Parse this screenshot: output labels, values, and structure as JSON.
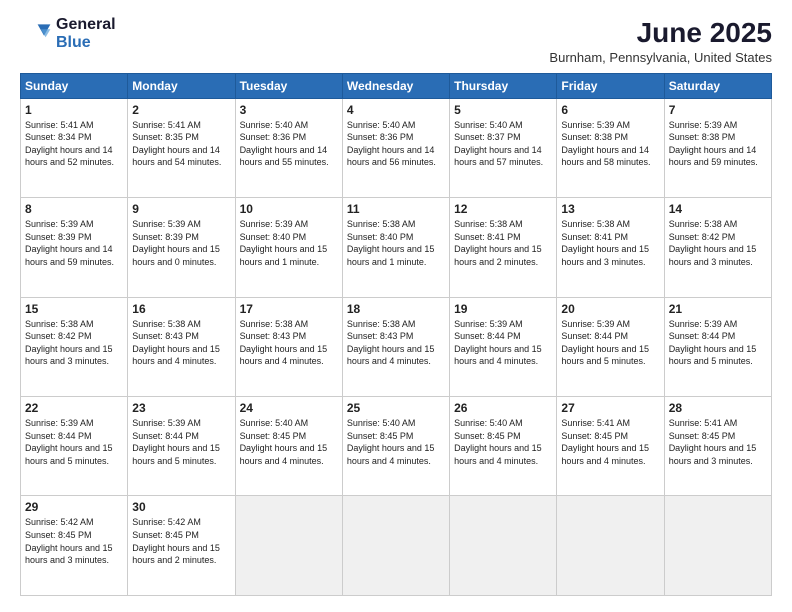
{
  "header": {
    "logo_general": "General",
    "logo_blue": "Blue",
    "month_title": "June 2025",
    "location": "Burnham, Pennsylvania, United States"
  },
  "days_of_week": [
    "Sunday",
    "Monday",
    "Tuesday",
    "Wednesday",
    "Thursday",
    "Friday",
    "Saturday"
  ],
  "weeks": [
    [
      {
        "day": "1",
        "sunrise": "5:41 AM",
        "sunset": "8:34 PM",
        "daylight": "14 hours and 52 minutes."
      },
      {
        "day": "2",
        "sunrise": "5:41 AM",
        "sunset": "8:35 PM",
        "daylight": "14 hours and 54 minutes."
      },
      {
        "day": "3",
        "sunrise": "5:40 AM",
        "sunset": "8:36 PM",
        "daylight": "14 hours and 55 minutes."
      },
      {
        "day": "4",
        "sunrise": "5:40 AM",
        "sunset": "8:36 PM",
        "daylight": "14 hours and 56 minutes."
      },
      {
        "day": "5",
        "sunrise": "5:40 AM",
        "sunset": "8:37 PM",
        "daylight": "14 hours and 57 minutes."
      },
      {
        "day": "6",
        "sunrise": "5:39 AM",
        "sunset": "8:38 PM",
        "daylight": "14 hours and 58 minutes."
      },
      {
        "day": "7",
        "sunrise": "5:39 AM",
        "sunset": "8:38 PM",
        "daylight": "14 hours and 59 minutes."
      }
    ],
    [
      {
        "day": "8",
        "sunrise": "5:39 AM",
        "sunset": "8:39 PM",
        "daylight": "14 hours and 59 minutes."
      },
      {
        "day": "9",
        "sunrise": "5:39 AM",
        "sunset": "8:39 PM",
        "daylight": "15 hours and 0 minutes."
      },
      {
        "day": "10",
        "sunrise": "5:39 AM",
        "sunset": "8:40 PM",
        "daylight": "15 hours and 1 minute."
      },
      {
        "day": "11",
        "sunrise": "5:38 AM",
        "sunset": "8:40 PM",
        "daylight": "15 hours and 1 minute."
      },
      {
        "day": "12",
        "sunrise": "5:38 AM",
        "sunset": "8:41 PM",
        "daylight": "15 hours and 2 minutes."
      },
      {
        "day": "13",
        "sunrise": "5:38 AM",
        "sunset": "8:41 PM",
        "daylight": "15 hours and 3 minutes."
      },
      {
        "day": "14",
        "sunrise": "5:38 AM",
        "sunset": "8:42 PM",
        "daylight": "15 hours and 3 minutes."
      }
    ],
    [
      {
        "day": "15",
        "sunrise": "5:38 AM",
        "sunset": "8:42 PM",
        "daylight": "15 hours and 3 minutes."
      },
      {
        "day": "16",
        "sunrise": "5:38 AM",
        "sunset": "8:43 PM",
        "daylight": "15 hours and 4 minutes."
      },
      {
        "day": "17",
        "sunrise": "5:38 AM",
        "sunset": "8:43 PM",
        "daylight": "15 hours and 4 minutes."
      },
      {
        "day": "18",
        "sunrise": "5:38 AM",
        "sunset": "8:43 PM",
        "daylight": "15 hours and 4 minutes."
      },
      {
        "day": "19",
        "sunrise": "5:39 AM",
        "sunset": "8:44 PM",
        "daylight": "15 hours and 4 minutes."
      },
      {
        "day": "20",
        "sunrise": "5:39 AM",
        "sunset": "8:44 PM",
        "daylight": "15 hours and 5 minutes."
      },
      {
        "day": "21",
        "sunrise": "5:39 AM",
        "sunset": "8:44 PM",
        "daylight": "15 hours and 5 minutes."
      }
    ],
    [
      {
        "day": "22",
        "sunrise": "5:39 AM",
        "sunset": "8:44 PM",
        "daylight": "15 hours and 5 minutes."
      },
      {
        "day": "23",
        "sunrise": "5:39 AM",
        "sunset": "8:44 PM",
        "daylight": "15 hours and 5 minutes."
      },
      {
        "day": "24",
        "sunrise": "5:40 AM",
        "sunset": "8:45 PM",
        "daylight": "15 hours and 4 minutes."
      },
      {
        "day": "25",
        "sunrise": "5:40 AM",
        "sunset": "8:45 PM",
        "daylight": "15 hours and 4 minutes."
      },
      {
        "day": "26",
        "sunrise": "5:40 AM",
        "sunset": "8:45 PM",
        "daylight": "15 hours and 4 minutes."
      },
      {
        "day": "27",
        "sunrise": "5:41 AM",
        "sunset": "8:45 PM",
        "daylight": "15 hours and 4 minutes."
      },
      {
        "day": "28",
        "sunrise": "5:41 AM",
        "sunset": "8:45 PM",
        "daylight": "15 hours and 3 minutes."
      }
    ],
    [
      {
        "day": "29",
        "sunrise": "5:42 AM",
        "sunset": "8:45 PM",
        "daylight": "15 hours and 3 minutes."
      },
      {
        "day": "30",
        "sunrise": "5:42 AM",
        "sunset": "8:45 PM",
        "daylight": "15 hours and 2 minutes."
      },
      null,
      null,
      null,
      null,
      null
    ]
  ]
}
